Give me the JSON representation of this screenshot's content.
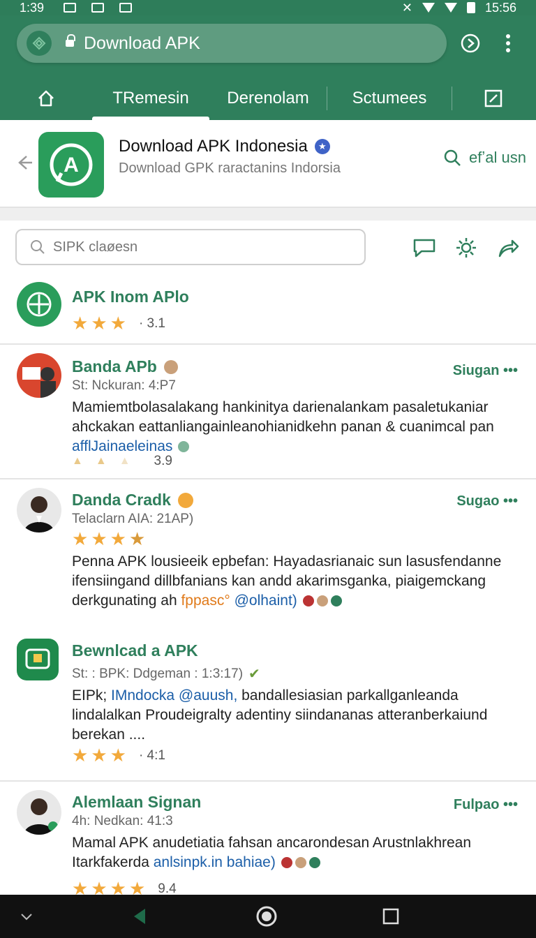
{
  "status_bar": {
    "time": "1:39",
    "clock_right": "15:56"
  },
  "header": {
    "url": "Download APK",
    "tabs": [
      {
        "label": "TRemesin",
        "active": true
      },
      {
        "label": "Derenolam",
        "active": false
      },
      {
        "label": "Sctumees",
        "active": false
      }
    ]
  },
  "app": {
    "title": "Download APK Indonesia",
    "subtitle": "Download GPK raractanins Indorsia",
    "action_label": "efʼal usn",
    "icon_glyph": "A"
  },
  "search": {
    "placeholder": "SIPK claøesn"
  },
  "items": [
    {
      "title": "APK Inom APlo",
      "rating": "· 3.1",
      "stars": 3,
      "avatar_color": "#2a9d5b"
    },
    {
      "title": "Banda APb",
      "meta": "St: Nckuran: 4:P7",
      "action": "Siugan •••",
      "body_line1": "Mamiemtbolasalakang hankinitya darienalankam pasaletukaniar",
      "body_line2": "ahckakan eattanliangainleanohianidkehn panan & cuanimcal pan",
      "body_link": "afflJainaeleinas",
      "rating": "3.9",
      "avatar_color": "#d9462e"
    },
    {
      "title": "Danda Cradk",
      "meta": "Telaclarn AIA: 21AP)",
      "action": "Sugao •••",
      "body_line1": "Penna APK lousieeik epbefan: Hayadasrianaic sun lasusfendanne",
      "body_line2": "ifensiingand dillbfanians kan andd akarimsganka, piaigemckang",
      "body_line3_prefix": "derkgunating ah ",
      "body_orange": "fppasc°",
      "body_link": " @olhaint)",
      "avatar_color": "#3a3a3a"
    },
    {
      "title": "Bewnlcad a APK",
      "meta": "St: : BPK: Ddgeman : 1:3:17)",
      "body_line1_prefix": "EIPk; ",
      "body_link": "IMndocka @auush,",
      "body_line1_suffix": " bandallesiasian parkallganleanda",
      "body_line2": "lindalalkan Proudeigralty adentiny siindananas atteranberkaiund",
      "body_line3": "berekan ....",
      "rating": "· 4:1",
      "stars": 3,
      "avatar_color": "#1f8a4c"
    },
    {
      "title": "Alemlaan Signan",
      "meta": "4h: Nedkan: 41:3",
      "action": "Fulpao •••",
      "body_line1": "Mamal APK anudetiatia fahsan ancarondesan Arustnlakhrean",
      "body_line2_prefix": "Itarkfakerda ",
      "body_link": "anlsinpk.in bahiae)",
      "rating": "9.4",
      "avatar_color": "#3a3a3a"
    }
  ],
  "colors": {
    "primary": "#2f7f5c",
    "accent_star": "#f2a93b",
    "link": "#1b5ea8"
  }
}
